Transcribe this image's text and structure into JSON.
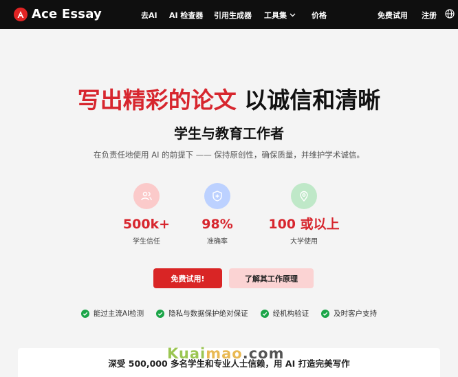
{
  "nav": {
    "brand": "Ace Essay",
    "links": [
      "去AI",
      "AI 检查器",
      "引用生成器",
      "工具集",
      "价格"
    ],
    "free_trial": "免费试用",
    "register": "注册"
  },
  "hero": {
    "title_red": "写出精彩的论文",
    "title_black": "以诚信和清晰",
    "subtitle": "学生与教育工作者",
    "description": "在负责任地使用 AI 的前提下 —— 保持原创性，确保质量，并维护学术诚信。"
  },
  "stats": [
    {
      "value": "500k+",
      "label": "学生信任",
      "icon": "users-icon",
      "color": "#f9c6c6"
    },
    {
      "value": "98%",
      "label": "准确率",
      "icon": "shield-plus-icon",
      "color": "#bcd1ff"
    },
    {
      "value": "100 或以上",
      "label": "大学使用",
      "icon": "location-pin-icon",
      "color": "#bfe8c8"
    }
  ],
  "buttons": {
    "primary": "免费试用!",
    "secondary": "了解其工作原理"
  },
  "features": [
    "能过主流AI检测",
    "隐私与数据保护绝对保证",
    "经机构验证",
    "及时客户支持"
  ],
  "trust": "深受 500,000 多名学生和专业人士信赖，用 AI 打造完美写作",
  "watermark": {
    "p1": "Kuai",
    "p2": "mao",
    "p3": ".com"
  },
  "colors": {
    "accent": "#d92525",
    "nav_bg": "#0f0f0f",
    "check": "#1ba548"
  }
}
